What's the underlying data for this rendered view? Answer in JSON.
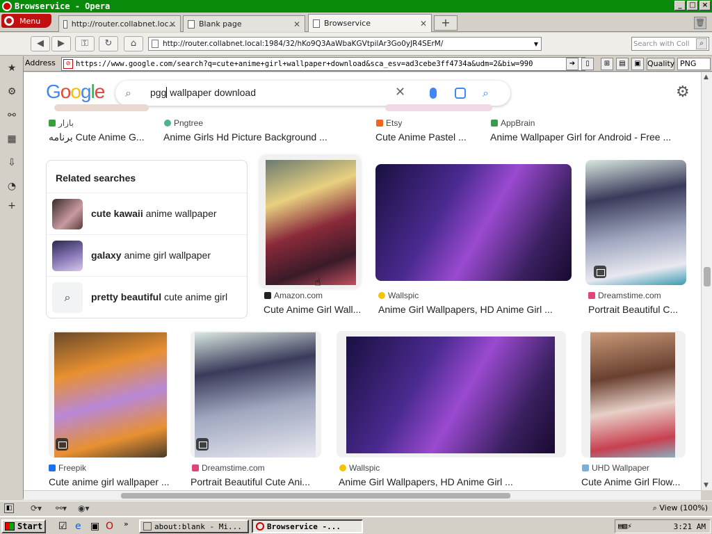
{
  "window": {
    "title": "Browservice - Opera"
  },
  "menu": {
    "label": "Menu"
  },
  "tabs": [
    {
      "label": "http://router.collabnet.loc..."
    },
    {
      "label": "Blank page"
    },
    {
      "label": "Browservice"
    }
  ],
  "nav": {
    "url": "http://router.collabnet.local:1984/32/hKo9Q3AaWbaKGVtpilAr3Go0yJR4SErM/",
    "search_placeholder": "Search with Coll"
  },
  "address": {
    "label": "Address",
    "url": "https://www.google.com/search?q=cute+anime+girl+wallpaper+download&sca_esv=ad3cebe3ff4734a&udm=2&biw=990",
    "quality_label": "Quality",
    "format": "PNG"
  },
  "google": {
    "logo": "Google",
    "query_before_cursor": "pgg",
    "query_after_cursor": " wallpaper download"
  },
  "top_row": [
    {
      "source": "بازار",
      "caption": "برنامه Cute Anime G...",
      "icon_color": "#3c9d3c"
    },
    {
      "source": "Pngtree",
      "caption": "Anime Girls Hd Picture Background ...",
      "icon_color": "#4fb38f"
    },
    {
      "source": "Etsy",
      "caption": "Cute Anime Pastel ...",
      "icon_color": "#f16521"
    },
    {
      "source": "AppBrain",
      "caption": "Anime Wallpaper Girl for Android - Free ...",
      "icon_color": "#3d9a4a"
    }
  ],
  "related": {
    "title": "Related searches",
    "items": [
      {
        "bold": "cute kawaii",
        "rest": " anime wallpaper"
      },
      {
        "bold": "galaxy",
        "rest": " anime girl wallpaper"
      },
      {
        "bold": "pretty beautiful",
        "rest": " cute anime girl"
      }
    ]
  },
  "row2": [
    {
      "source": "Amazon.com",
      "caption": "Cute Anime Girl Wall...",
      "icon_color": "#222222"
    },
    {
      "source": "Wallspic",
      "caption": "Anime Girl Wallpapers, HD Anime Girl ...",
      "icon_color": "#f5c400"
    },
    {
      "source": "Dreamstime.com",
      "caption": "Portrait Beautiful C...",
      "icon_color": "#e0447a"
    }
  ],
  "row3": [
    {
      "source": "Freepik",
      "caption": "Cute anime girl wallpaper ...",
      "icon_color": "#1a73e8"
    },
    {
      "source": "Dreamstime.com",
      "caption": "Portrait Beautiful Cute Ani...",
      "icon_color": "#e0447a"
    },
    {
      "source": "Wallspic",
      "caption": "Anime Girl Wallpapers, HD Anime Girl ...",
      "icon_color": "#f5c400"
    },
    {
      "source": "UHD Wallpaper",
      "caption": "Cute Anime Girl Flow...",
      "icon_color": "#7ab0d8"
    }
  ],
  "status": {
    "zoom": "View (100%)"
  },
  "taskbar": {
    "start": "Start",
    "tasks": [
      {
        "label": "about:blank - Mi..."
      },
      {
        "label": "Browservice -..."
      }
    ],
    "clock": "3:21 AM"
  },
  "colors": {
    "accent_green": "#0a8a0a",
    "opera_red": "#c21010",
    "google_blue": "#4285f4"
  }
}
